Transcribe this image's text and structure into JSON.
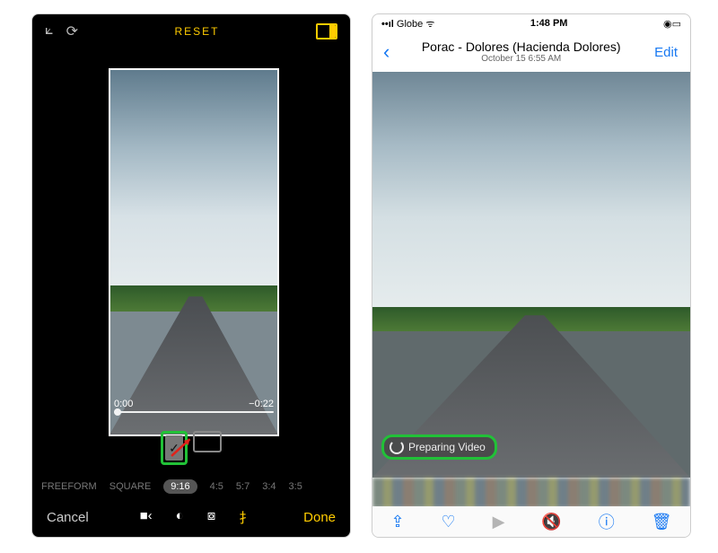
{
  "left": {
    "colors": {
      "accent": "#ffcc00",
      "highlight": "#21c137",
      "arrow": "#e1221a"
    },
    "toolbar": {
      "reset": "RESET"
    },
    "trim": {
      "start": "0:00",
      "end": "−0:22"
    },
    "orientation": {
      "selected": "portrait"
    },
    "ratios": [
      "FREEFORM",
      "SQUARE",
      "9:16",
      "4:5",
      "5:7",
      "3:4",
      "3:5"
    ],
    "selected_ratio_index": 2,
    "bottom": {
      "cancel": "Cancel",
      "done": "Done"
    },
    "tools": {
      "video": "video-icon",
      "adjust": "adjust-icon",
      "filters": "filters-icon",
      "crop": "crop-icon"
    }
  },
  "right": {
    "status": {
      "carrier": "Globe",
      "signal": "••ıl",
      "wifi": "wifi",
      "time": "1:48 PM",
      "battery": "battery"
    },
    "nav": {
      "back_glyph": "‹",
      "title": "Porac - Dolores (Hacienda Dolores)",
      "subtitle": "October 15  6:55 AM",
      "edit": "Edit"
    },
    "preparing_pill": "Preparing Video",
    "bottom_icons": {
      "share": "share",
      "favorite": "heart",
      "play": "play",
      "mute": "mute",
      "info": "info",
      "trash": "trash"
    }
  }
}
